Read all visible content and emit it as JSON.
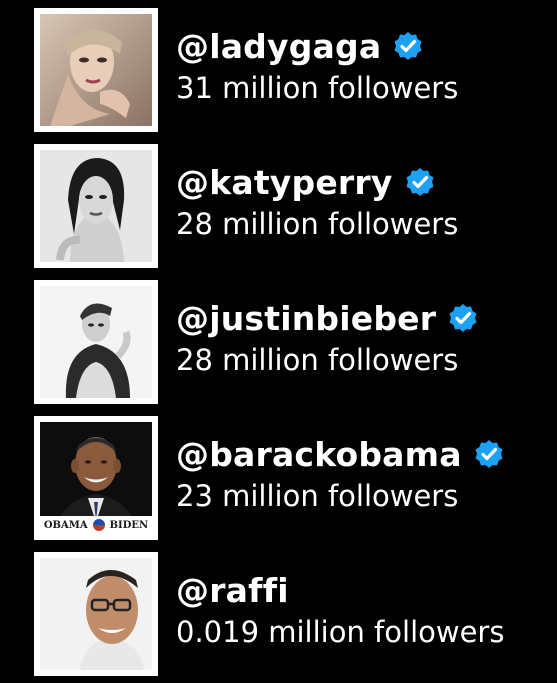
{
  "accounts": [
    {
      "handle": "@ladygaga",
      "followers": "31 million followers",
      "verified": true,
      "avatar": "ladygaga-photo"
    },
    {
      "handle": "@katyperry",
      "followers": "28 million followers",
      "verified": true,
      "avatar": "katyperry-photo"
    },
    {
      "handle": "@justinbieber",
      "followers": "28 million followers",
      "verified": true,
      "avatar": "justinbieber-photo"
    },
    {
      "handle": "@barackobama",
      "followers": "23 million followers",
      "verified": true,
      "avatar": "barackobama-photo",
      "campaign_left": "OBAMA",
      "campaign_right": "BIDEN"
    },
    {
      "handle": "@raffi",
      "followers": "0.019 million followers",
      "verified": false,
      "avatar": "raffi-photo"
    }
  ],
  "colors": {
    "background": "#000000",
    "text": "#ffffff",
    "verified_badge": "#1da1f2"
  }
}
